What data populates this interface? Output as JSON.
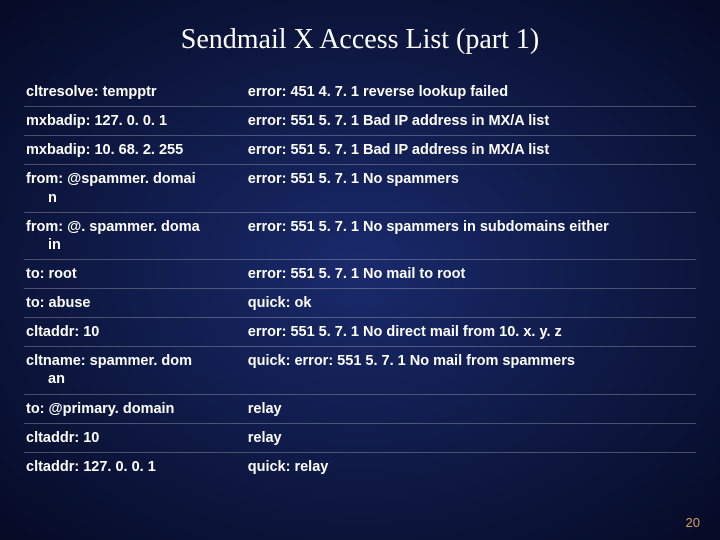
{
  "title": "Sendmail X Access List (part 1)",
  "page_number": "20",
  "rows": [
    {
      "left_line1": "cltresolve: tempptr",
      "left_line2": "",
      "right": "error: 451 4. 7. 1 reverse lookup failed"
    },
    {
      "left_line1": "mxbadip: 127. 0. 0. 1",
      "left_line2": "",
      "right": "error: 551 5. 7. 1 Bad IP address in MX/A list"
    },
    {
      "left_line1": "mxbadip: 10. 68. 2. 255",
      "left_line2": "",
      "right": "error: 551 5. 7. 1 Bad IP address in MX/A list"
    },
    {
      "left_line1": "from: @spammer. domai",
      "left_line2": "n",
      "right": "error: 551 5. 7. 1 No spammers"
    },
    {
      "left_line1": "from: @. spammer. doma",
      "left_line2": "in",
      "right": "error: 551 5. 7. 1 No spammers in subdomains either"
    },
    {
      "left_line1": "to: root",
      "left_line2": "",
      "right": "error: 551 5. 7. 1 No mail to root"
    },
    {
      "left_line1": "to: abuse",
      "left_line2": "",
      "right": "quick: ok"
    },
    {
      "left_line1": "cltaddr: 10",
      "left_line2": "",
      "right": "error: 551 5. 7. 1 No direct mail from 10. x. y. z"
    },
    {
      "left_line1": "cltname: spammer. dom",
      "left_line2": "an",
      "right": "quick: error: 551 5. 7. 1 No mail from spammers"
    },
    {
      "left_line1": "to: @primary. domain",
      "left_line2": "",
      "right": "relay"
    },
    {
      "left_line1": "cltaddr: 10",
      "left_line2": "",
      "right": "relay"
    },
    {
      "left_line1": "cltaddr: 127. 0. 0. 1",
      "left_line2": "",
      "right": "quick: relay"
    }
  ]
}
